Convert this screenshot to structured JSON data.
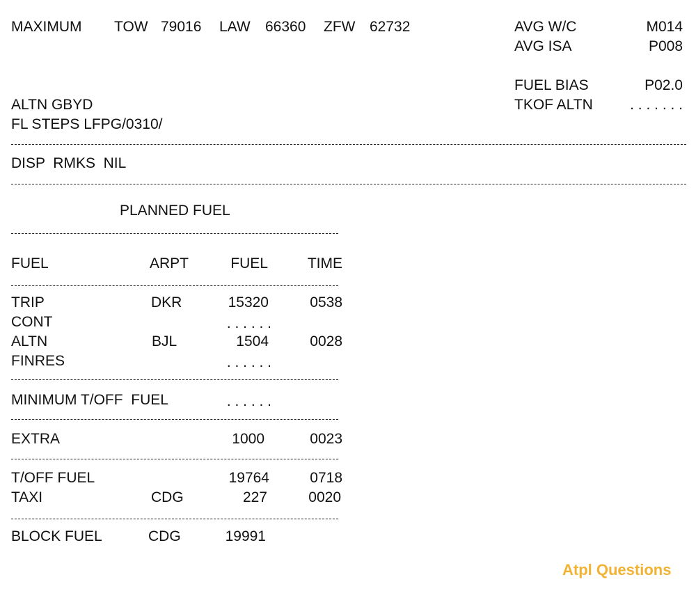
{
  "header": {
    "maximum_label": "MAXIMUM",
    "tow_label": "TOW",
    "tow_value": "79016",
    "law_label": "LAW",
    "law_value": "66360",
    "zfw_label": "ZFW",
    "zfw_value": "62732"
  },
  "right_block": {
    "avg_wc_label": "AVG W/C",
    "avg_wc_value": "M014",
    "avg_isa_label": "AVG ISA",
    "avg_isa_value": "P008",
    "fuel_bias_label": "FUEL BIAS",
    "fuel_bias_value": "P02.0",
    "tkof_altn_label": "TKOF ALTN",
    "tkof_altn_value": ". . . . . . ."
  },
  "route": {
    "altn_line": "ALTN GBYD",
    "fl_steps_line": "FL STEPS LFPG/0310/"
  },
  "remarks": "DISP  RMKS  NIL",
  "planned_fuel_title": "PLANNED FUEL",
  "table": {
    "headers": {
      "fuel": "FUEL",
      "arpt": "ARPT",
      "amount": "FUEL",
      "time": "TIME"
    },
    "rows": [
      {
        "fuel": "TRIP",
        "arpt": "DKR",
        "amount": "15320",
        "time": "0538"
      },
      {
        "fuel": "CONT",
        "arpt": "",
        "amount": ". . . . . .",
        "time": ""
      },
      {
        "fuel": "ALTN",
        "arpt": "BJL",
        "amount": "1504",
        "time": "0028"
      },
      {
        "fuel": "FINRES",
        "arpt": "",
        "amount": ". . . . . .",
        "time": ""
      }
    ],
    "minimum": {
      "label": "MINIMUM T/OFF  FUEL",
      "amount": ". . . . . ."
    },
    "extra": {
      "label": "EXTRA",
      "amount": "1000",
      "time": "0023"
    },
    "toff": {
      "label": "T/OFF FUEL",
      "amount": "19764",
      "time": "0718"
    },
    "taxi": {
      "label": "TAXI",
      "arpt": "CDG",
      "amount": "227",
      "time": "0020"
    },
    "block": {
      "label": "BLOCK FUEL",
      "arpt": "CDG",
      "amount": "19991"
    }
  },
  "watermark": {
    "text": "Atpl Questions",
    "color": "#f2b233"
  }
}
